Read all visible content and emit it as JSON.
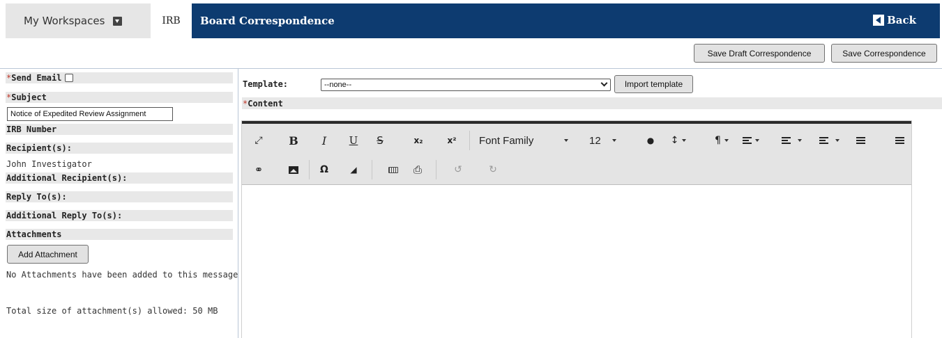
{
  "nav": {
    "workspaces_label": "My Workspaces",
    "irb_tab_label": "IRB",
    "page_title": "Board Correspondence",
    "back_label": "Back"
  },
  "actions": {
    "save_draft_label": "Save Draft Correspondence",
    "save_label": "Save Correspondence"
  },
  "left": {
    "required_mark": "*",
    "send_email_label": "Send Email",
    "send_email_checked": false,
    "subject_label": "Subject",
    "subject_value": "Notice of Expedited Review Assignment",
    "irb_number_label": "IRB Number",
    "recipients_label": "Recipient(s):",
    "recipients_value": "John Investigator",
    "additional_recipients_label": "Additional Recipient(s):",
    "reply_to_label": "Reply To(s):",
    "additional_reply_to_label": "Additional Reply To(s):",
    "attachments_label": "Attachments",
    "add_attachment_label": "Add Attachment",
    "no_attachments_text": "No Attachments have been added to this message",
    "size_limit_text": "Total size of attachment(s) allowed: 50 MB"
  },
  "right": {
    "template_label": "Template:",
    "template_selected": "--none--",
    "import_template_label": "Import template",
    "content_label": "Content"
  },
  "editor": {
    "font_family_label": "Font Family",
    "font_size_value": "12",
    "bold_glyph": "B",
    "italic_glyph": "I",
    "underline_glyph": "U",
    "strike_glyph": "S",
    "subscript_glyph": "x₂",
    "superscript_glyph": "x²",
    "expand_glyph": "⤢",
    "color_glyph": "●",
    "line_height_glyph": "↕",
    "paragraph_glyph": "¶",
    "link_glyph": "⚭",
    "omega_glyph": "Ω",
    "eraser_glyph": "◢",
    "print_glyph": "⎙",
    "undo_glyph": "↺",
    "redo_glyph": "↻",
    "icons": [
      "expand-icon",
      "bold-icon",
      "italic-icon",
      "underline-icon",
      "strikethrough-icon",
      "subscript-icon",
      "superscript-icon",
      "text-color-icon",
      "line-height-icon",
      "paragraph-icon",
      "align-icon",
      "ordered-list-icon",
      "unordered-list-icon",
      "outdent-icon",
      "indent-icon",
      "link-icon",
      "image-icon",
      "special-char-icon",
      "clear-format-icon",
      "keyboard-icon",
      "print-icon",
      "undo-icon",
      "redo-icon"
    ]
  },
  "colors": {
    "header_blue": "#0d3b70",
    "required_red": "#c0392b",
    "label_gray_bg": "#e8e8e8",
    "toolbar_bg": "#e4e4e4"
  }
}
